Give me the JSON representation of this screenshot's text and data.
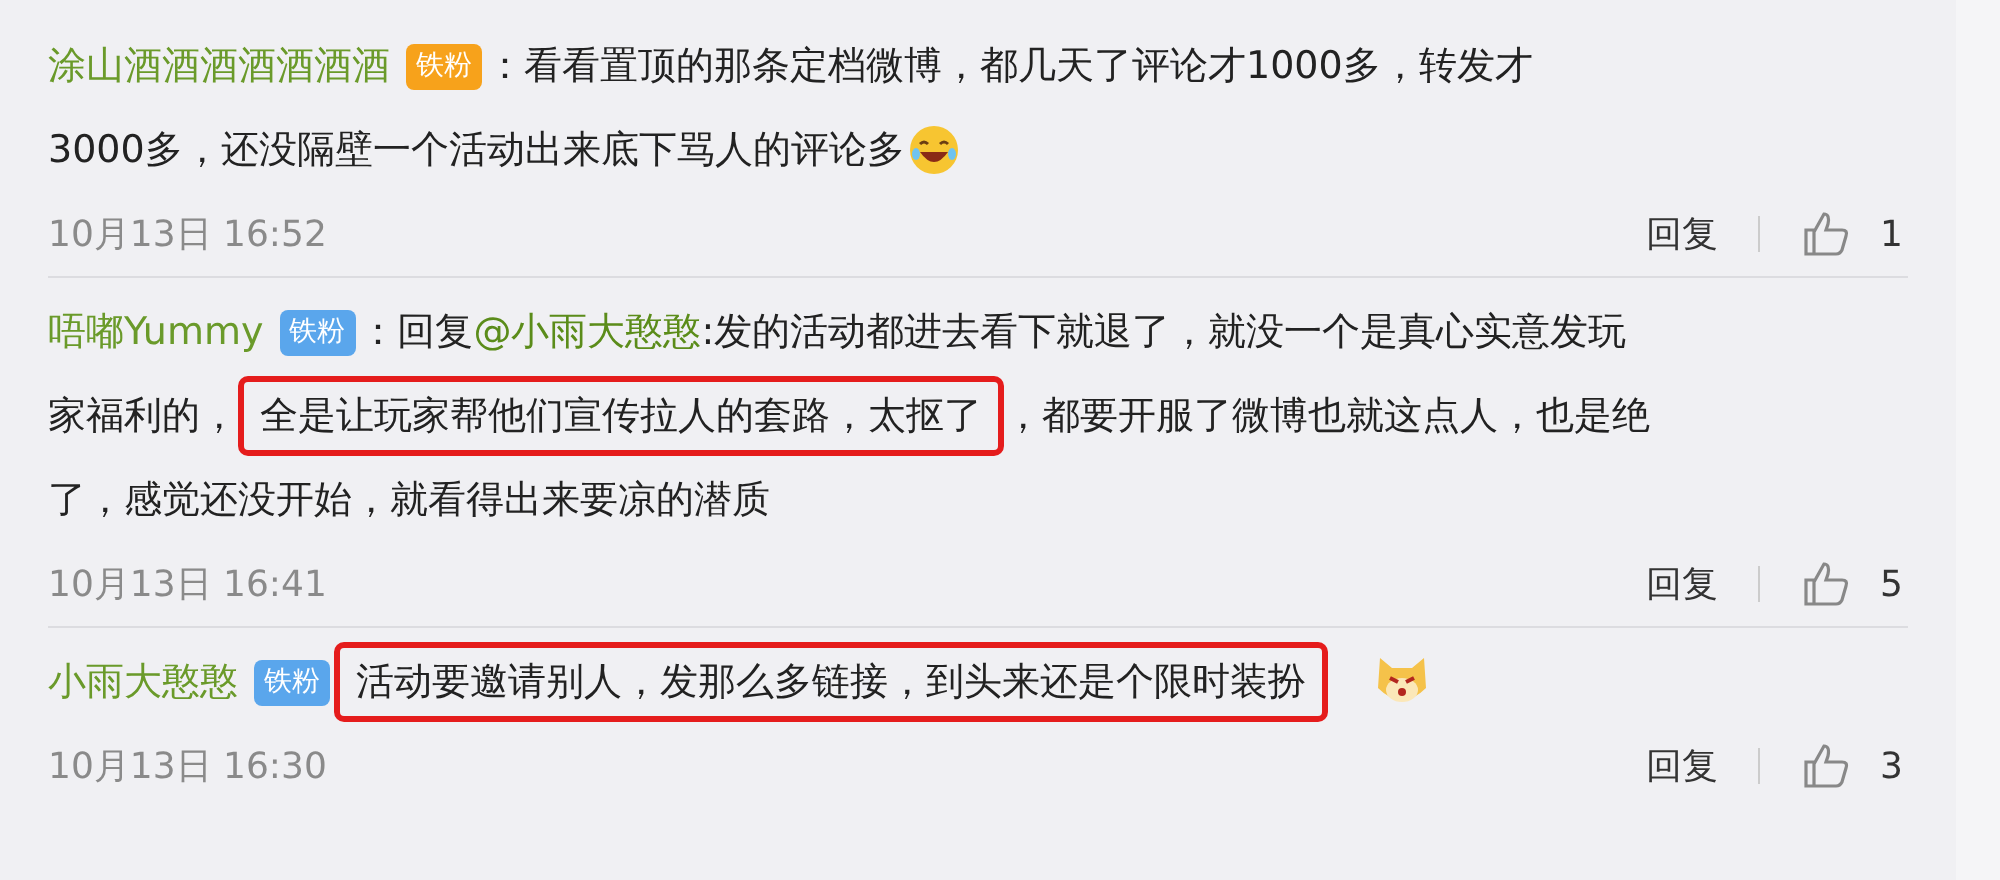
{
  "comments": [
    {
      "name": "涂山酒酒酒酒酒酒酒",
      "badge": {
        "kind": "gold",
        "label": "铁粉"
      },
      "lines": [
        [
          {
            "kind": "plain",
            "text": "：看看置顶的那条定档微博，都几天了评论才1000多，转发才"
          }
        ],
        [
          {
            "kind": "plain",
            "text": "3000多，还没隔壁一个活动出来底下骂人的评论多"
          }
        ]
      ],
      "emoji": {
        "kind": "laughing"
      },
      "time": "10月13日 16:52",
      "reply": "回复",
      "likes": "1"
    },
    {
      "name": "唔嘟Yummy",
      "badge": {
        "kind": "blue",
        "label": "铁粉"
      },
      "lines": [
        [
          {
            "kind": "plain",
            "text": "：回复"
          },
          {
            "kind": "mention",
            "text": "@小雨大憨憨"
          },
          {
            "kind": "plain",
            "text": ":发的活动都进去看下就退了，就没一个是真心实意发玩"
          }
        ],
        [
          {
            "kind": "plain",
            "text": "家福利的，"
          },
          {
            "kind": "highlight",
            "text": "全是让玩家帮他们宣传拉人的套路，太抠了"
          },
          {
            "kind": "plain",
            "text": "，都要开服了微博也就这点人，也是绝"
          }
        ],
        [
          {
            "kind": "plain",
            "text": "了，感觉还没开始，就看得出来要凉的潜质"
          }
        ]
      ],
      "time": "10月13日 16:41",
      "reply": "回复",
      "likes": "5"
    },
    {
      "name": "小雨大憨憨",
      "badge": {
        "kind": "blue",
        "label": "铁粉"
      },
      "lines": [
        [
          {
            "kind": "highlight",
            "text": "活动要邀请别人，发那么多链接，到头来还是个限时装扮"
          }
        ]
      ],
      "emoji": {
        "kind": "dog"
      },
      "time": "10月13日 16:30",
      "reply": "回复",
      "likes": "3"
    }
  ]
}
